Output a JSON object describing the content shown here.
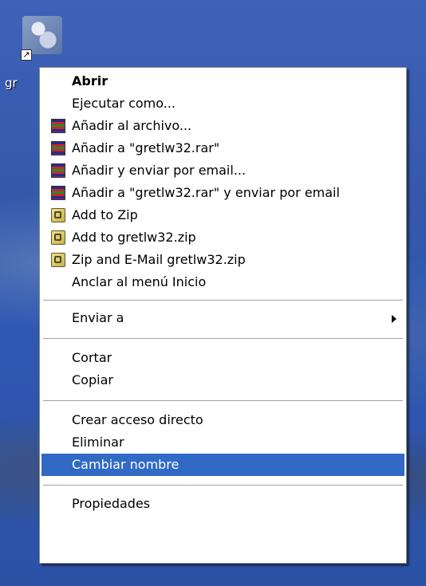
{
  "desktop": {
    "icon_label": "gr"
  },
  "menu": {
    "items": [
      {
        "label": "Abrir",
        "bold": true,
        "icon": null
      },
      {
        "label": "Ejecutar como...",
        "icon": null
      },
      {
        "label": "Añadir al archivo...",
        "icon": "winrar-icon"
      },
      {
        "label": "Añadir a \"gretlw32.rar\"",
        "icon": "winrar-icon"
      },
      {
        "label": "Añadir y enviar por email...",
        "icon": "winrar-icon"
      },
      {
        "label": "Añadir a \"gretlw32.rar\" y enviar por email",
        "icon": "winrar-icon"
      },
      {
        "label": "Add to Zip",
        "icon": "winzip-icon"
      },
      {
        "label": "Add to gretlw32.zip",
        "icon": "winzip-icon"
      },
      {
        "label": "Zip and E-Mail gretlw32.zip",
        "icon": "winzip-icon"
      },
      {
        "label": "Anclar al menú Inicio",
        "icon": null
      },
      {
        "label": "Enviar a",
        "icon": null,
        "submenu": true
      },
      {
        "label": "Cortar",
        "icon": null
      },
      {
        "label": "Copiar",
        "icon": null
      },
      {
        "label": "Crear acceso directo",
        "icon": null
      },
      {
        "label": "Eliminar",
        "icon": null
      },
      {
        "label": "Cambiar nombre",
        "icon": null,
        "highlighted": true
      },
      {
        "label": "Propiedades",
        "icon": null
      }
    ],
    "highlight_color": "#316ac5"
  }
}
